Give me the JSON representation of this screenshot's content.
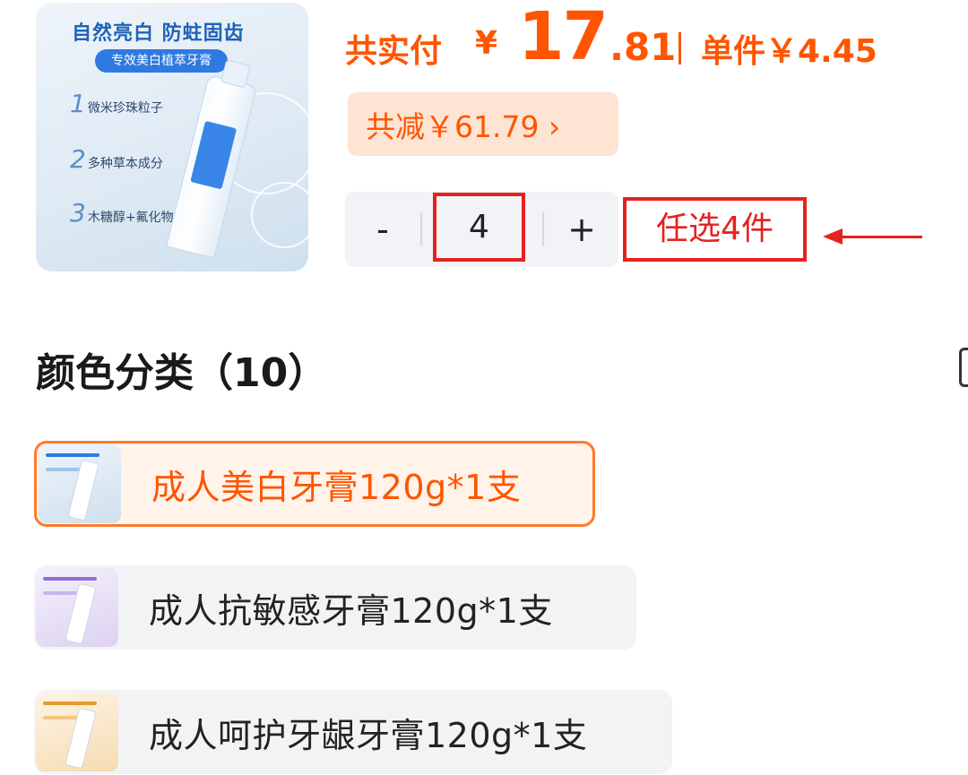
{
  "product": {
    "thumbnail": {
      "headline": "自然亮白 防蛀固齿",
      "ribbon": "专效美白植萃牙膏",
      "features": [
        {
          "num": "1",
          "text": "微米珍珠粒子"
        },
        {
          "num": "2",
          "text": "多种草本成分"
        },
        {
          "num": "3",
          "text": "木糖醇+氟化物"
        }
      ]
    }
  },
  "price": {
    "lead_label": "共实付",
    "currency": "¥",
    "integer": "17",
    "decimal": ".81",
    "unit_price": "单件￥4.45",
    "discount_label": "共减￥61.79 ›"
  },
  "quantity": {
    "minus": "-",
    "value": "4",
    "plus": "+"
  },
  "annotation": {
    "label": "任选4件"
  },
  "variants": {
    "title": "颜色分类（10）",
    "items": [
      {
        "label": "成人美白牙膏120g*1支",
        "selected": true,
        "theme": "#9cc4ec"
      },
      {
        "label": "成人抗敏感牙膏120g*1支",
        "selected": false,
        "theme": "#c9b6ea"
      },
      {
        "label": "成人呵护牙龈牙膏120g*1支",
        "selected": false,
        "theme": "#f2c680"
      }
    ]
  },
  "colors": {
    "accent": "#ff5500",
    "annotation_red": "#e52220",
    "discount_bg": "#fde4d3",
    "stepper_bg": "#f1f3f6"
  }
}
